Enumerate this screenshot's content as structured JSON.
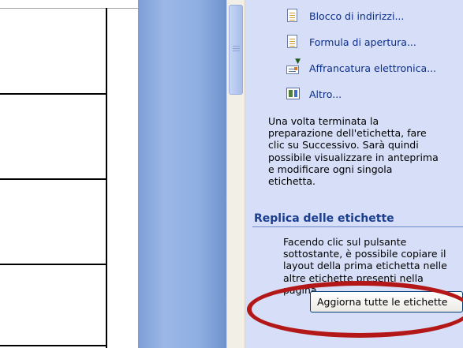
{
  "task_pane": {
    "links": [
      {
        "label": "Blocco di indirizzi...",
        "icon": "address-block-icon"
      },
      {
        "label": "Formula di apertura...",
        "icon": "greeting-line-icon"
      },
      {
        "label": "Affrancatura elettronica...",
        "icon": "electronic-postage-icon"
      },
      {
        "label": "Altro...",
        "icon": "more-items-icon"
      }
    ],
    "instructions": [
      "Una volta terminata la",
      "preparazione dell'etichetta, fare",
      "clic su Successivo. Sarà quindi",
      "possibile visualizzare in anteprima",
      "e modificare ogni singola",
      "etichetta."
    ],
    "replicate_section": {
      "title": "Replica delle etichette",
      "description": [
        "Facendo clic sul pulsante",
        "sottostante, è possibile copiare il",
        "layout della prima etichetta nelle",
        "altre etichette presenti nella",
        "pagina."
      ],
      "button_label": "Aggiorna tutte le etichette"
    }
  },
  "colors": {
    "task_pane_bg": "#d6dff7",
    "link_text": "#0b2d8a",
    "section_title": "#1a3d8f",
    "highlight": "#b31717",
    "blue_band": "#8eaee2"
  }
}
